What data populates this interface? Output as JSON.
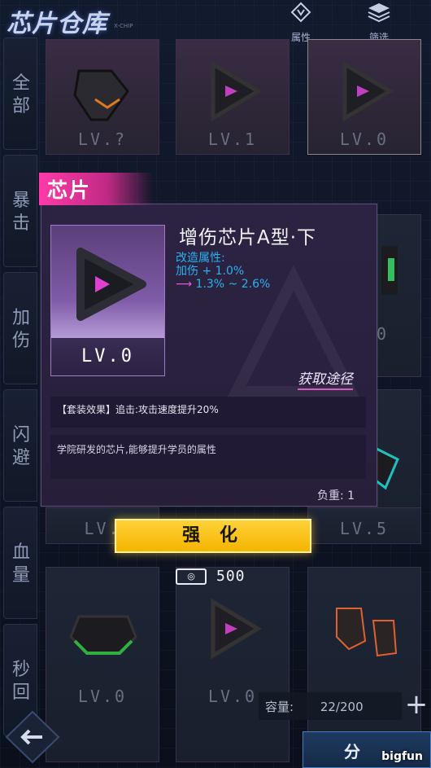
{
  "header": {
    "title": "芯片仓库",
    "title_sub": "X-CHIP",
    "buttons": [
      {
        "label": "属性",
        "icon": "attribute-icon"
      },
      {
        "label": "筛选",
        "icon": "filter-icon"
      }
    ]
  },
  "sidebar": {
    "tabs": [
      {
        "label": "全部"
      },
      {
        "label": "暴击"
      },
      {
        "label": "加伤"
      },
      {
        "label": "闪避"
      },
      {
        "label": "血量"
      },
      {
        "label": "秒回"
      }
    ]
  },
  "grid": {
    "rows": [
      [
        "LV.?",
        "LV.1",
        "LV.0"
      ],
      [
        "",
        "",
        "LV.0"
      ],
      [
        "",
        "",
        ""
      ],
      [
        "LV.",
        "",
        "LV.5"
      ],
      [
        "LV.0",
        "LV.0",
        ""
      ]
    ]
  },
  "capacity": {
    "label": "容量:",
    "value": "22/200"
  },
  "decompose": {
    "label": "分"
  },
  "watermark": "bigfun",
  "popup": {
    "tag": "芯片",
    "thumb_level": "LV.0",
    "name": "增伤芯片A型·下",
    "attr_title": "改造属性:",
    "attr_line": "加伤 + 1.0%",
    "attr_range": "1.3% ~ 2.6%",
    "get_path": "获取途径",
    "set_effect": "【套装效果】追击:攻击速度提升20%",
    "description": "学院研发的芯片,能够提升学员的属性",
    "weight": "负重: 1"
  },
  "action": {
    "strengthen_label": "强 化",
    "cost_icon": "currency-icon",
    "cost_value": "500"
  },
  "colors": {
    "accent_pink": "#ff3aa8",
    "attr_blue": "#28b2f0",
    "button_yellow": "#ffd23a"
  }
}
